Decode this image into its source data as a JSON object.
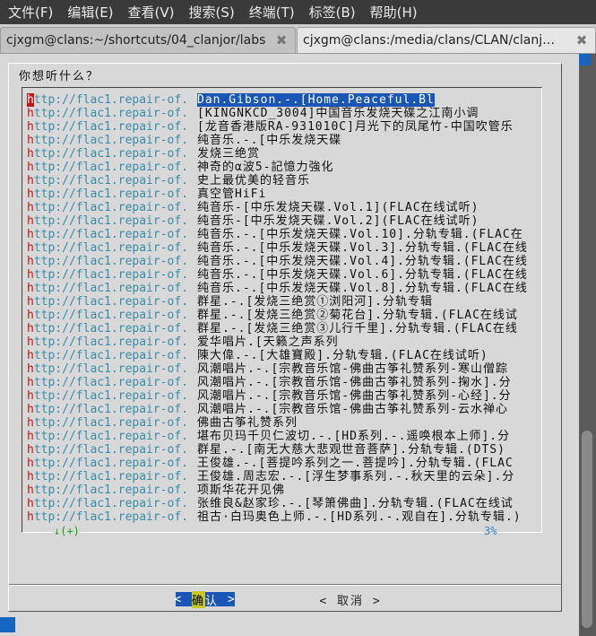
{
  "menubar": {
    "items": [
      {
        "label": "文件(F)"
      },
      {
        "label": "编辑(E)"
      },
      {
        "label": "查看(V)"
      },
      {
        "label": "搜索(S)"
      },
      {
        "label": "终端(T)"
      },
      {
        "label": "标签(B)"
      },
      {
        "label": "帮助(H)"
      }
    ]
  },
  "tabs": [
    {
      "title": "cjxgm@clans:~/shortcuts/04_clanjor/labs",
      "close": "✖"
    },
    {
      "title": "cjxgm@clans:/media/clans/CLAN/clanj…",
      "close": "✖"
    }
  ],
  "dialog": {
    "prompt": "你想听什么？",
    "rows": [
      {
        "tag_first": "h",
        "tag_rest": "ttp://flac1.repair-of.",
        "desc": "Dan.Gibson.-.[Home.Peaceful.Bl",
        "selected": true
      },
      {
        "tag_first": "h",
        "tag_rest": "ttp://flac1.repair-of.",
        "desc": "[KINGNKCD_3004]中国音乐发烧天碟之江南小调"
      },
      {
        "tag_first": "h",
        "tag_rest": "ttp://flac1.repair-of.",
        "desc": "[龙音香港版RA-931010C]月光下的凤尾竹-中国吹管乐"
      },
      {
        "tag_first": "h",
        "tag_rest": "ttp://flac1.repair-of.",
        "desc": "纯音乐.-.[中乐发烧天碟"
      },
      {
        "tag_first": "h",
        "tag_rest": "ttp://flac1.repair-of.",
        "desc": "发烧三绝赏"
      },
      {
        "tag_first": "h",
        "tag_rest": "ttp://flac1.repair-of.",
        "desc": "神奇的α波5-記憶力強化"
      },
      {
        "tag_first": "h",
        "tag_rest": "ttp://flac1.repair-of.",
        "desc": "史上最优美的轻音乐"
      },
      {
        "tag_first": "h",
        "tag_rest": "ttp://flac1.repair-of.",
        "desc": "真空管HiFi"
      },
      {
        "tag_first": "h",
        "tag_rest": "ttp://flac1.repair-of.",
        "desc": "纯音乐-[中乐发烧天碟.Vol.1](FLAC在线试听)"
      },
      {
        "tag_first": "h",
        "tag_rest": "ttp://flac1.repair-of.",
        "desc": "纯音乐-[中乐发烧天碟.Vol.2](FLAC在线试听)"
      },
      {
        "tag_first": "h",
        "tag_rest": "ttp://flac1.repair-of.",
        "desc": "纯音乐.-.[中乐发烧天碟.Vol.10].分轨专辑.(FLAC在"
      },
      {
        "tag_first": "h",
        "tag_rest": "ttp://flac1.repair-of.",
        "desc": "纯音乐.-.[中乐发烧天碟.Vol.3].分轨专辑.(FLAC在线"
      },
      {
        "tag_first": "h",
        "tag_rest": "ttp://flac1.repair-of.",
        "desc": "纯音乐.-.[中乐发烧天碟.Vol.4].分轨专辑.(FLAC在线"
      },
      {
        "tag_first": "h",
        "tag_rest": "ttp://flac1.repair-of.",
        "desc": "纯音乐.-.[中乐发烧天碟.Vol.6].分轨专辑.(FLAC在线"
      },
      {
        "tag_first": "h",
        "tag_rest": "ttp://flac1.repair-of.",
        "desc": "纯音乐.-.[中乐发烧天碟.Vol.8].分轨专辑.(FLAC在线"
      },
      {
        "tag_first": "h",
        "tag_rest": "ttp://flac1.repair-of.",
        "desc": "群星.-.[发烧三绝赏①浏阳河].分轨专辑"
      },
      {
        "tag_first": "h",
        "tag_rest": "ttp://flac1.repair-of.",
        "desc": "群星.-.[发烧三绝赏②菊花台].分轨专辑.(FLAC在线试"
      },
      {
        "tag_first": "h",
        "tag_rest": "ttp://flac1.repair-of.",
        "desc": "群星.-.[发烧三绝赏③儿行千里].分轨专辑.(FLAC在线"
      },
      {
        "tag_first": "h",
        "tag_rest": "ttp://flac1.repair-of.",
        "desc": "爱华唱片.[天籁之声系列"
      },
      {
        "tag_first": "h",
        "tag_rest": "ttp://flac1.repair-of.",
        "desc": "陳大偉.-.[大雄寶殿].分轨专辑.(FLAC在线试听)"
      },
      {
        "tag_first": "h",
        "tag_rest": "ttp://flac1.repair-of.",
        "desc": "风潮唱片.-.[宗教音乐馆-佛曲古筝礼赞系列-寒山僧踪"
      },
      {
        "tag_first": "h",
        "tag_rest": "ttp://flac1.repair-of.",
        "desc": "风潮唱片.-.[宗教音乐馆-佛曲古筝礼赞系列-掬水].分"
      },
      {
        "tag_first": "h",
        "tag_rest": "ttp://flac1.repair-of.",
        "desc": "风潮唱片.-.[宗教音乐馆-佛曲古筝礼赞系列-心经].分"
      },
      {
        "tag_first": "h",
        "tag_rest": "ttp://flac1.repair-of.",
        "desc": "风潮唱片.-.[宗教音乐馆-佛曲古筝礼赞系列-云水禅心"
      },
      {
        "tag_first": "h",
        "tag_rest": "ttp://flac1.repair-of.",
        "desc": "佛曲古筝礼赞系列"
      },
      {
        "tag_first": "h",
        "tag_rest": "ttp://flac1.repair-of.",
        "desc": "堪布贝玛千贝仁波切.-.[HD系列.-.遥唤根本上师].分"
      },
      {
        "tag_first": "h",
        "tag_rest": "ttp://flac1.repair-of.",
        "desc": "群星.-.[南无大慈大悲观世音菩萨].分轨专辑.(DTS)"
      },
      {
        "tag_first": "h",
        "tag_rest": "ttp://flac1.repair-of.",
        "desc": "王俊雄.-.[菩提吟系列之一.菩提吟].分轨专辑.(FLAC"
      },
      {
        "tag_first": "h",
        "tag_rest": "ttp://flac1.repair-of.",
        "desc": "王俊雄.周志宏.-.[浮生梦事系列.-.秋天里的云朵].分"
      },
      {
        "tag_first": "h",
        "tag_rest": "ttp://flac1.repair-of.",
        "desc": "项斯华花开见佛"
      },
      {
        "tag_first": "h",
        "tag_rest": "ttp://flac1.repair-of.",
        "desc": "张维良&赵家珍.-.[琴箫佛曲].分轨专辑.(FLAC在线试"
      },
      {
        "tag_first": "h",
        "tag_rest": "ttp://flac1.repair-of.",
        "desc": "祖古·白玛奥色上师.-.[HD系列.-.观自在].分轨专辑.)"
      }
    ],
    "more_indicator": "↓(+)",
    "scroll_percent": "3%",
    "ok_button": {
      "left": "<",
      "hot": "确",
      "rest": "认",
      "right": ">"
    },
    "cancel_button": {
      "label": "< 取消 >"
    }
  }
}
